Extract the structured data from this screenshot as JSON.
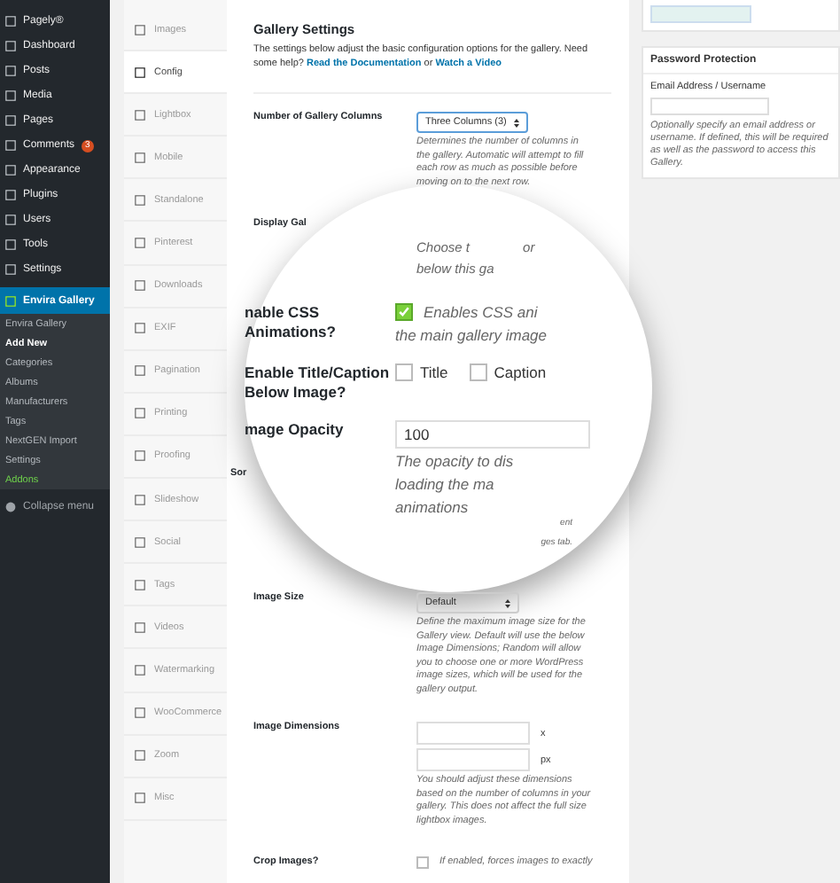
{
  "admin_menu": [
    {
      "label": "Pagely®",
      "kind": "main",
      "selected": false
    },
    {
      "label": "Dashboard",
      "kind": "main",
      "selected": false
    },
    {
      "label": "Posts",
      "kind": "main",
      "selected": false
    },
    {
      "label": "Media",
      "kind": "main",
      "selected": false
    },
    {
      "label": "Pages",
      "kind": "main",
      "selected": false
    },
    {
      "label": "Comments",
      "kind": "main",
      "selected": false,
      "badge": "3"
    },
    {
      "label": "Appearance",
      "kind": "main",
      "selected": false
    },
    {
      "label": "Plugins",
      "kind": "main",
      "selected": false
    },
    {
      "label": "Users",
      "kind": "main",
      "selected": false
    },
    {
      "label": "Tools",
      "kind": "main",
      "selected": false
    },
    {
      "label": "Settings",
      "kind": "main",
      "selected": false
    },
    {
      "label": "Envira Gallery",
      "kind": "main",
      "selected": true
    },
    {
      "label": "Envira Gallery",
      "kind": "sub",
      "selected": false
    },
    {
      "label": "Add New",
      "kind": "sub",
      "selected": true
    },
    {
      "label": "Categories",
      "kind": "sub",
      "selected": false
    },
    {
      "label": "Albums",
      "kind": "sub",
      "selected": false
    },
    {
      "label": "Manufacturers",
      "kind": "sub",
      "selected": false
    },
    {
      "label": "Tags",
      "kind": "sub",
      "selected": false
    },
    {
      "label": "NextGEN Import",
      "kind": "sub",
      "selected": false
    },
    {
      "label": "Settings",
      "kind": "sub",
      "selected": false
    },
    {
      "label": "Addons",
      "kind": "addon",
      "selected": false
    },
    {
      "label": "Collapse menu",
      "kind": "collapse",
      "selected": false
    }
  ],
  "tabs": [
    {
      "label": "Images",
      "selected": false
    },
    {
      "label": "Config",
      "selected": true
    },
    {
      "label": "Lightbox",
      "selected": false
    },
    {
      "label": "Mobile",
      "selected": false
    },
    {
      "label": "Standalone",
      "selected": false
    },
    {
      "label": "Pinterest",
      "selected": false
    },
    {
      "label": "Downloads",
      "selected": false
    },
    {
      "label": "EXIF",
      "selected": false
    },
    {
      "label": "Pagination",
      "selected": false
    },
    {
      "label": "Printing",
      "selected": false
    },
    {
      "label": "Proofing",
      "selected": false
    },
    {
      "label": "Slideshow",
      "selected": false
    },
    {
      "label": "Social",
      "selected": false
    },
    {
      "label": "Tags",
      "selected": false
    },
    {
      "label": "Videos",
      "selected": false
    },
    {
      "label": "Watermarking",
      "selected": false
    },
    {
      "label": "WooCommerce",
      "selected": false
    },
    {
      "label": "Zoom",
      "selected": false
    },
    {
      "label": "Misc",
      "selected": false
    }
  ],
  "settings": {
    "title": "Gallery Settings",
    "intro": "The settings below adjust the basic configuration options for the gallery. Need some help?",
    "links": [
      "Read the Documentation",
      "Watch a Video"
    ],
    "link_joiner": "or",
    "rows": [
      {
        "kind": "select",
        "label": "Number of Gallery Columns",
        "value": "Three Columns (3)",
        "magnified": false,
        "description": "Determines the number of columns in the gallery. Automatic will attempt to fill each row as much as possible before moving on to the next row."
      },
      {
        "kind": "text",
        "label": "Display Gal",
        "magnified": false,
        "description_lines": [
          "Choose t",
          "below this ga"
        ],
        "aside": "or"
      },
      {
        "kind": "checkbox",
        "label": "nable CSS Animations?",
        "magnified": true,
        "checked": true,
        "description_lines": [
          "Enables CSS ani",
          "the main gallery image"
        ]
      },
      {
        "kind": "checkboxes",
        "label": "Enable Title/Caption Below Image?",
        "magnified": true,
        "options": [
          {
            "label": "Title",
            "checked": false
          },
          {
            "label": "Caption",
            "checked": false
          }
        ]
      },
      {
        "kind": "input",
        "label": "mage Opacity",
        "magnified": true,
        "value": "100",
        "description_lines": [
          "The opacity to dis",
          "loading the ma",
          "animations"
        ],
        "under_label": "Sor",
        "under_notes": [
          "ent",
          "ges tab."
        ]
      },
      {
        "kind": "select",
        "label": "Image Size",
        "value": "Default",
        "magnified": false,
        "description": "Define the maximum image size for the Gallery view. Default will use the below Image Dimensions; Random will allow you to choose one or more WordPress image sizes, which will be used for the gallery output."
      },
      {
        "kind": "dimensions",
        "label": "Image Dimensions",
        "magnified": false,
        "units": [
          "x",
          "px"
        ],
        "description": "You should adjust these dimensions based on the number of columns in your gallery. This does not affect the full size lightbox images."
      },
      {
        "kind": "checkbox",
        "label": "Crop Images?",
        "magnified": false,
        "checked": false,
        "description_lines": [
          "If enabled, forces images to exactly"
        ]
      }
    ]
  },
  "side_boxes": {
    "title": "Password Protection",
    "field_label": "Email Address / Username",
    "description": "Optionally specify an email address or username. If defined, this will be required as well as the password to access this Gallery."
  }
}
